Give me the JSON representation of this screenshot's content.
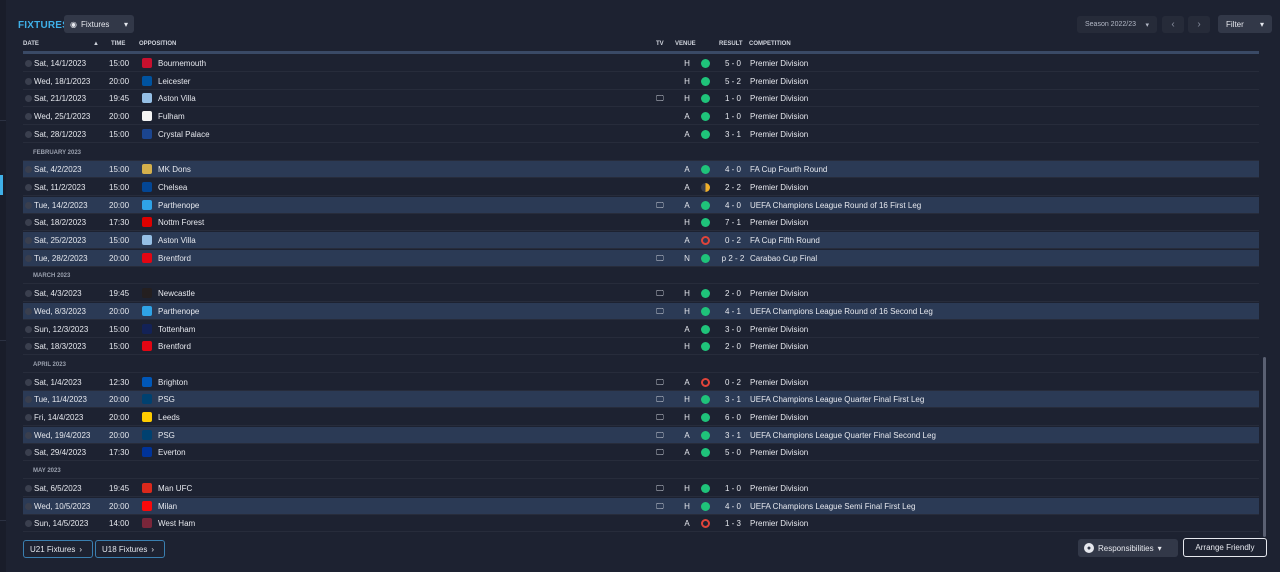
{
  "page": {
    "title": "FIXTURES",
    "view_dropdown": "Fixtures",
    "season": "Season 2022/23",
    "filter": "Filter"
  },
  "columns": {
    "date": "DATE",
    "time": "TIME",
    "opposition": "OPPOSITION",
    "tv": "TV",
    "venue": "VENUE",
    "result": "RESULT",
    "competition": "COMPETITION"
  },
  "items": [
    {
      "kind": "match",
      "date": "Sat, 14/1/2023",
      "time": "15:00",
      "team": "Bournemouth",
      "crest": "#c8102e",
      "tv": false,
      "venue": "H",
      "outcome": "win",
      "score": "5 - 0",
      "competition": "Premier Division",
      "alt": false
    },
    {
      "kind": "match",
      "date": "Wed, 18/1/2023",
      "time": "20:00",
      "team": "Leicester",
      "crest": "#0053a0",
      "tv": false,
      "venue": "H",
      "outcome": "win",
      "score": "5 - 2",
      "competition": "Premier Division",
      "alt": false
    },
    {
      "kind": "match",
      "date": "Sat, 21/1/2023",
      "time": "19:45",
      "team": "Aston Villa",
      "crest": "#95bfe5",
      "tv": true,
      "venue": "H",
      "outcome": "win",
      "score": "1 - 0",
      "competition": "Premier Division",
      "alt": false
    },
    {
      "kind": "match",
      "date": "Wed, 25/1/2023",
      "time": "20:00",
      "team": "Fulham",
      "crest": "#f5f5f5",
      "tv": false,
      "venue": "A",
      "outcome": "win",
      "score": "1 - 0",
      "competition": "Premier Division",
      "alt": false
    },
    {
      "kind": "match",
      "date": "Sat, 28/1/2023",
      "time": "15:00",
      "team": "Crystal Palace",
      "crest": "#1b458f",
      "tv": false,
      "venue": "A",
      "outcome": "win",
      "score": "3 - 1",
      "competition": "Premier Division",
      "alt": false
    },
    {
      "kind": "month",
      "label": "FEBRUARY 2023"
    },
    {
      "kind": "match",
      "date": "Sat, 4/2/2023",
      "time": "15:00",
      "team": "MK Dons",
      "crest": "#d4b04c",
      "tv": false,
      "venue": "A",
      "outcome": "win",
      "score": "4 - 0",
      "competition": "FA Cup Fourth Round",
      "alt": true
    },
    {
      "kind": "match",
      "date": "Sat, 11/2/2023",
      "time": "15:00",
      "team": "Chelsea",
      "crest": "#034694",
      "tv": false,
      "venue": "A",
      "outcome": "draw",
      "score": "2 - 2",
      "competition": "Premier Division",
      "alt": false
    },
    {
      "kind": "match",
      "date": "Tue, 14/2/2023",
      "time": "20:00",
      "team": "Parthenope",
      "crest": "#2fa3e6",
      "tv": true,
      "venue": "A",
      "outcome": "win",
      "score": "4 - 0",
      "competition": "UEFA Champions League Round of 16 First Leg",
      "alt": true
    },
    {
      "kind": "match",
      "date": "Sat, 18/2/2023",
      "time": "17:30",
      "team": "Nottm Forest",
      "crest": "#dd0000",
      "tv": false,
      "venue": "H",
      "outcome": "win",
      "score": "7 - 1",
      "competition": "Premier Division",
      "alt": false
    },
    {
      "kind": "match",
      "date": "Sat, 25/2/2023",
      "time": "15:00",
      "team": "Aston Villa",
      "crest": "#95bfe5",
      "tv": false,
      "venue": "A",
      "outcome": "loss",
      "score": "0 - 2",
      "competition": "FA Cup Fifth Round",
      "alt": true
    },
    {
      "kind": "match",
      "date": "Tue, 28/2/2023",
      "time": "20:00",
      "team": "Brentford",
      "crest": "#e30613",
      "tv": true,
      "venue": "N",
      "outcome": "win",
      "score": "p 2 - 2",
      "competition": "Carabao Cup Final",
      "alt": true
    },
    {
      "kind": "month",
      "label": "MARCH 2023"
    },
    {
      "kind": "match",
      "date": "Sat, 4/3/2023",
      "time": "19:45",
      "team": "Newcastle",
      "crest": "#241f20",
      "tv": true,
      "venue": "H",
      "outcome": "win",
      "score": "2 - 0",
      "competition": "Premier Division",
      "alt": false
    },
    {
      "kind": "match",
      "date": "Wed, 8/3/2023",
      "time": "20:00",
      "team": "Parthenope",
      "crest": "#2fa3e6",
      "tv": true,
      "venue": "H",
      "outcome": "win",
      "score": "4 - 1",
      "competition": "UEFA Champions League Round of 16 Second Leg",
      "alt": true
    },
    {
      "kind": "match",
      "date": "Sun, 12/3/2023",
      "time": "15:00",
      "team": "Tottenham",
      "crest": "#132257",
      "tv": false,
      "venue": "A",
      "outcome": "win",
      "score": "3 - 0",
      "competition": "Premier Division",
      "alt": false
    },
    {
      "kind": "match",
      "date": "Sat, 18/3/2023",
      "time": "15:00",
      "team": "Brentford",
      "crest": "#e30613",
      "tv": false,
      "venue": "H",
      "outcome": "win",
      "score": "2 - 0",
      "competition": "Premier Division",
      "alt": false
    },
    {
      "kind": "month",
      "label": "APRIL 2023"
    },
    {
      "kind": "match",
      "date": "Sat, 1/4/2023",
      "time": "12:30",
      "team": "Brighton",
      "crest": "#0057b8",
      "tv": true,
      "venue": "A",
      "outcome": "loss",
      "score": "0 - 2",
      "competition": "Premier Division",
      "alt": false
    },
    {
      "kind": "match",
      "date": "Tue, 11/4/2023",
      "time": "20:00",
      "team": "PSG",
      "crest": "#004170",
      "tv": true,
      "venue": "H",
      "outcome": "win",
      "score": "3 - 1",
      "competition": "UEFA Champions League Quarter Final First Leg",
      "alt": true
    },
    {
      "kind": "match",
      "date": "Fri, 14/4/2023",
      "time": "20:00",
      "team": "Leeds",
      "crest": "#ffcd00",
      "tv": true,
      "venue": "H",
      "outcome": "win",
      "score": "6 - 0",
      "competition": "Premier Division",
      "alt": false
    },
    {
      "kind": "match",
      "date": "Wed, 19/4/2023",
      "time": "20:00",
      "team": "PSG",
      "crest": "#004170",
      "tv": true,
      "venue": "A",
      "outcome": "win",
      "score": "3 - 1",
      "competition": "UEFA Champions League Quarter Final Second Leg",
      "alt": true
    },
    {
      "kind": "match",
      "date": "Sat, 29/4/2023",
      "time": "17:30",
      "team": "Everton",
      "crest": "#003399",
      "tv": true,
      "venue": "A",
      "outcome": "win",
      "score": "5 - 0",
      "competition": "Premier Division",
      "alt": false
    },
    {
      "kind": "month",
      "label": "MAY 2023"
    },
    {
      "kind": "match",
      "date": "Sat, 6/5/2023",
      "time": "19:45",
      "team": "Man UFC",
      "crest": "#da291c",
      "tv": true,
      "venue": "H",
      "outcome": "win",
      "score": "1 - 0",
      "competition": "Premier Division",
      "alt": false
    },
    {
      "kind": "match",
      "date": "Wed, 10/5/2023",
      "time": "20:00",
      "team": "Milan",
      "crest": "#fb090b",
      "tv": true,
      "venue": "H",
      "outcome": "win",
      "score": "4 - 0",
      "competition": "UEFA Champions League Semi Final First Leg",
      "alt": true
    },
    {
      "kind": "match",
      "date": "Sun, 14/5/2023",
      "time": "14:00",
      "team": "West Ham",
      "crest": "#7a263a",
      "tv": false,
      "venue": "A",
      "outcome": "loss",
      "score": "1 - 3",
      "competition": "Premier Division",
      "alt": false
    }
  ],
  "bottom": {
    "u21": "U21 Fixtures",
    "u18": "U18 Fixtures",
    "responsibilities": "Responsibilities",
    "arrange": "Arrange Friendly"
  }
}
